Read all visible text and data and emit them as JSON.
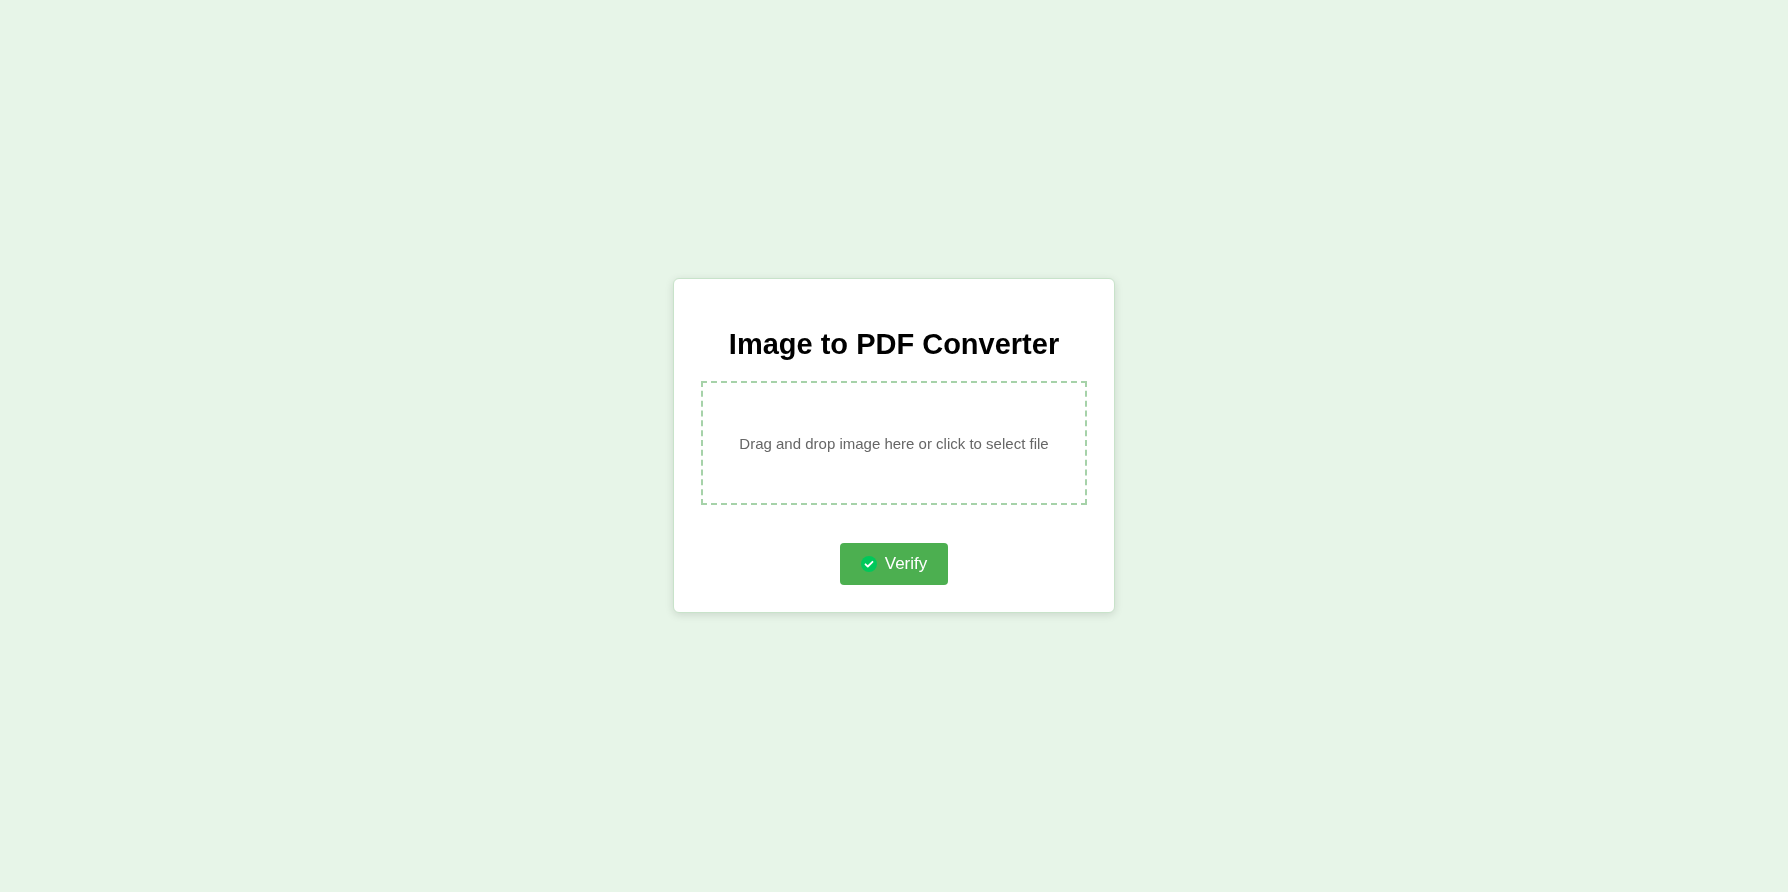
{
  "card": {
    "title": "Image to PDF Converter",
    "drop_zone": {
      "text": "Drag and drop image here or click to select file"
    },
    "buttons": [
      {
        "label": "Verify"
      }
    ]
  }
}
